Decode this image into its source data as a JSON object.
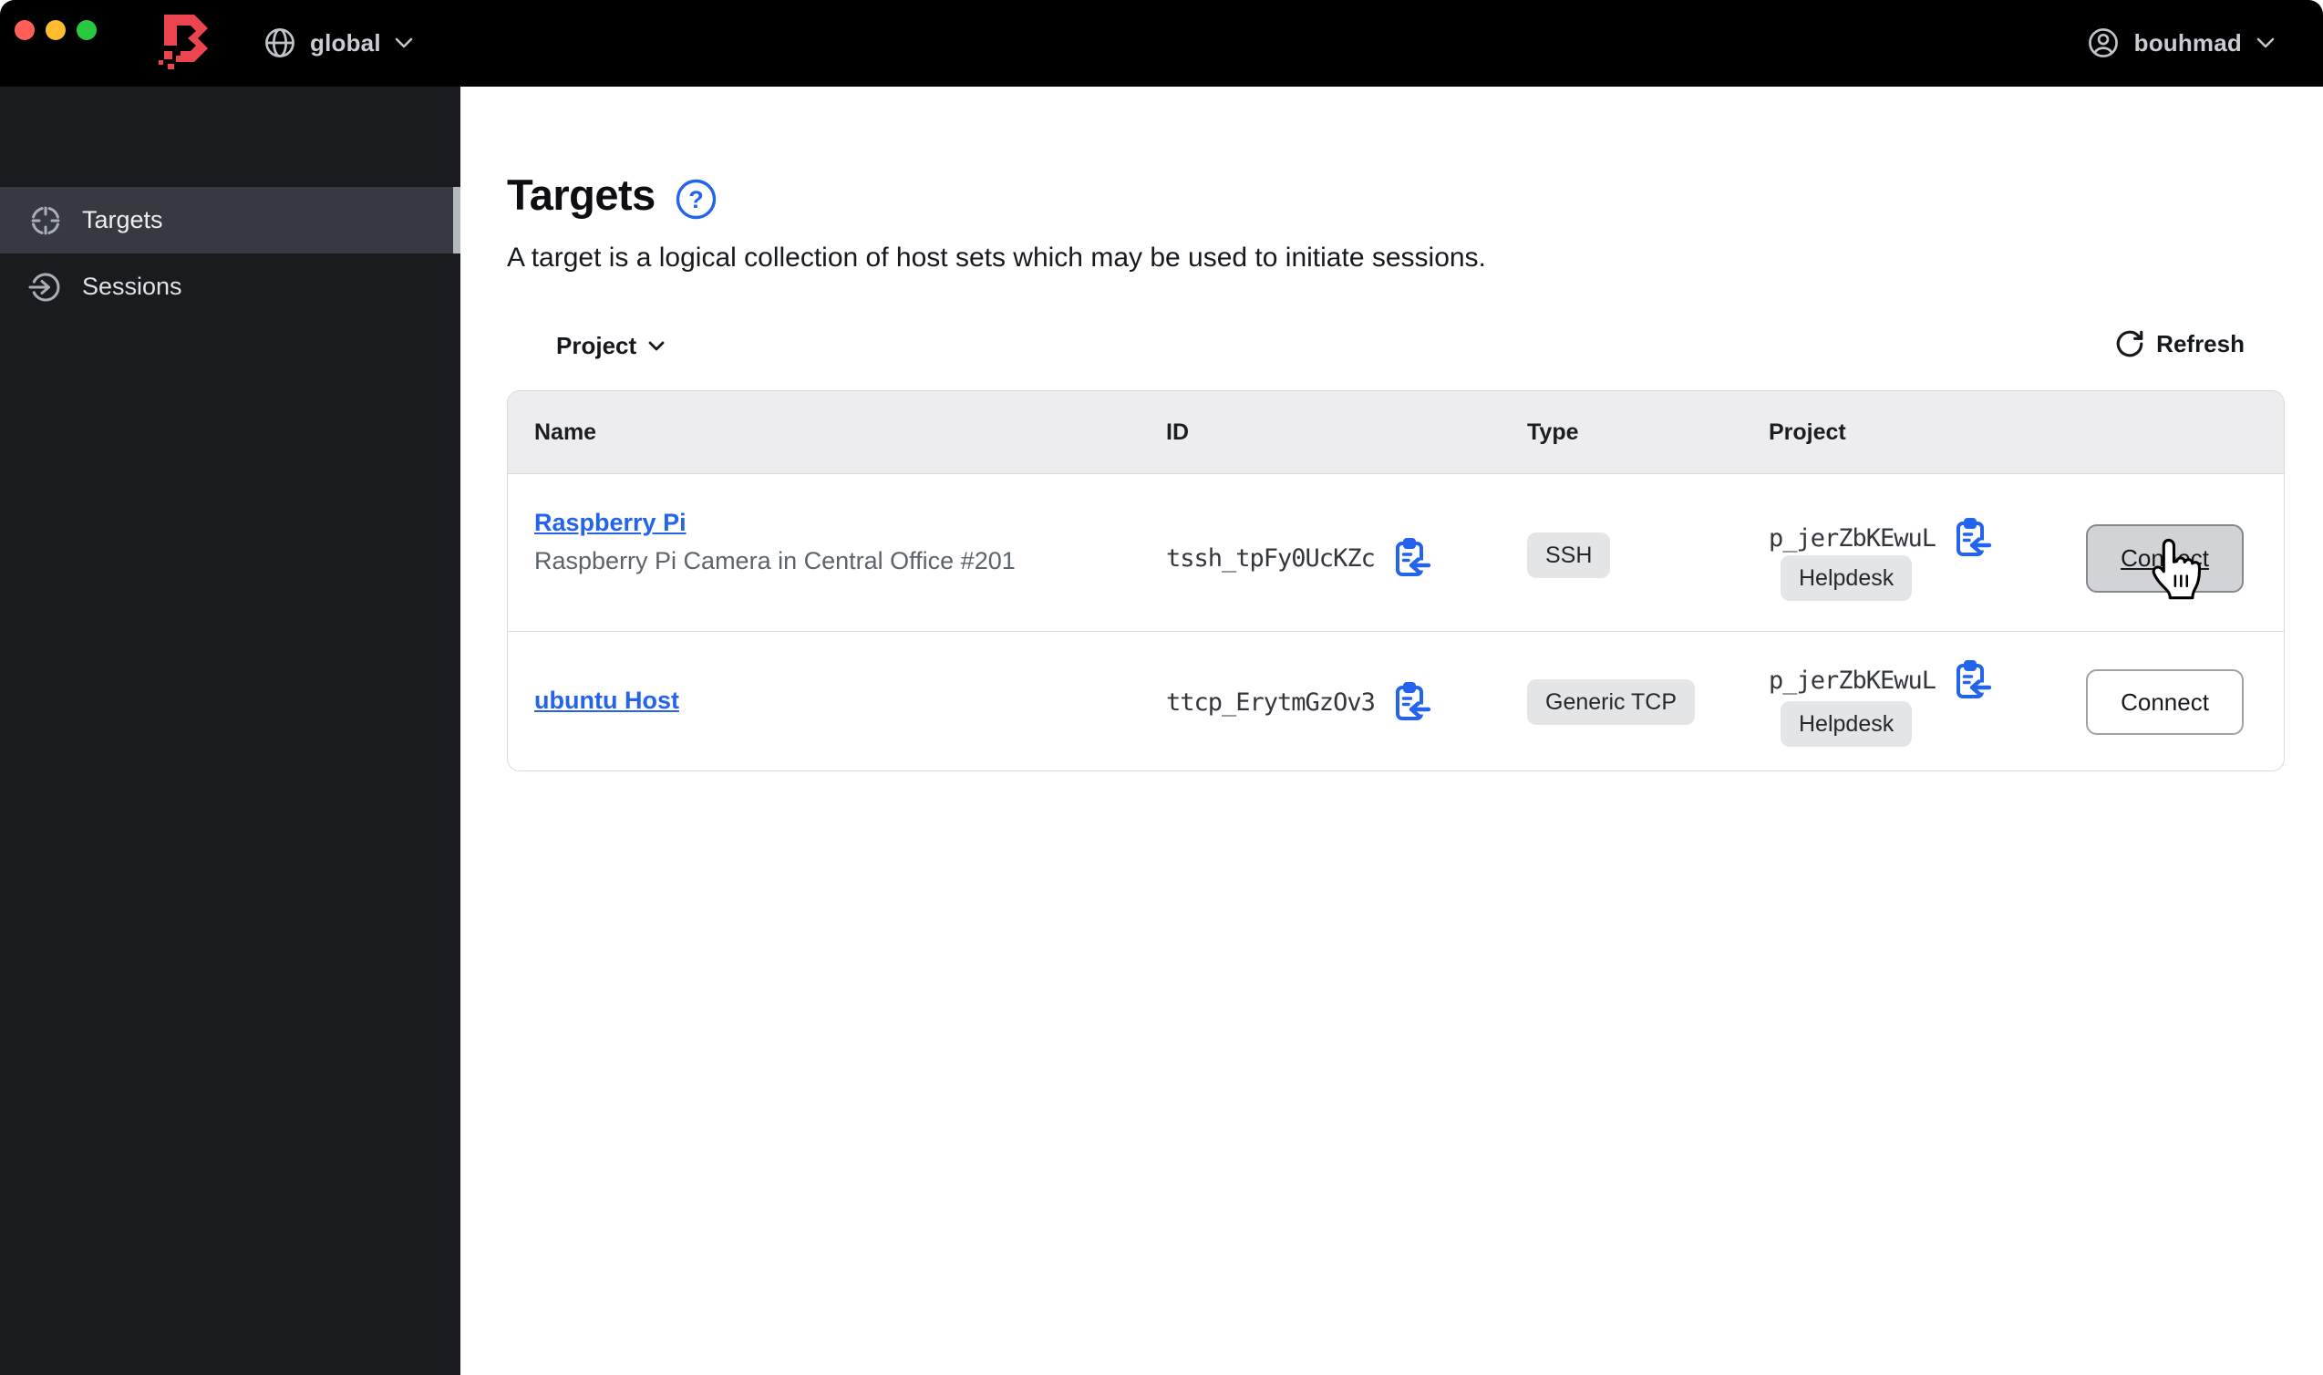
{
  "topbar": {
    "scope_label": "global",
    "user_label": "bouhmad"
  },
  "sidebar": {
    "items": [
      {
        "label": "Targets",
        "icon": "target-crosshair",
        "active": true
      },
      {
        "label": "Sessions",
        "icon": "session-arrow-circle",
        "active": false
      }
    ]
  },
  "main": {
    "title": "Targets",
    "subtitle": "A target is a logical collection of host sets which may be used to initiate sessions.",
    "filter_label": "Project",
    "refresh_label": "Refresh",
    "table": {
      "columns": [
        "Name",
        "ID",
        "Type",
        "Project"
      ],
      "rows": [
        {
          "name": "Raspberry Pi",
          "description": "Raspberry Pi Camera in Central Office #201",
          "id": "tssh_tpFy0UcKZc",
          "type": "SSH",
          "project_id": "p_jerZbKEwuL",
          "project_name": "Helpdesk",
          "action": "Connect"
        },
        {
          "name": "ubuntu Host",
          "description": "",
          "id": "ttcp_ErytmGzOv3",
          "type": "Generic TCP",
          "project_id": "p_jerZbKEwuL",
          "project_name": "Helpdesk",
          "action": "Connect"
        }
      ]
    }
  },
  "icons": {
    "help_glyph": "?",
    "logo": "boundary-logo",
    "copy": "clipboard-copy",
    "refresh": "rotate-cw",
    "scope": "globe",
    "user": "person-circle"
  },
  "colors": {
    "accent_blue": "#2463eb",
    "logo_red": "#ec454e",
    "topbar_bg": "#000000",
    "sidebar_bg": "#191b1f",
    "sidebar_active_bg": "#36393f",
    "badge_bg": "#e4e5e7",
    "table_header_bg": "#ededef",
    "traffic_red": "#ff5f57",
    "traffic_yellow": "#febc2e",
    "traffic_green": "#28c840"
  }
}
